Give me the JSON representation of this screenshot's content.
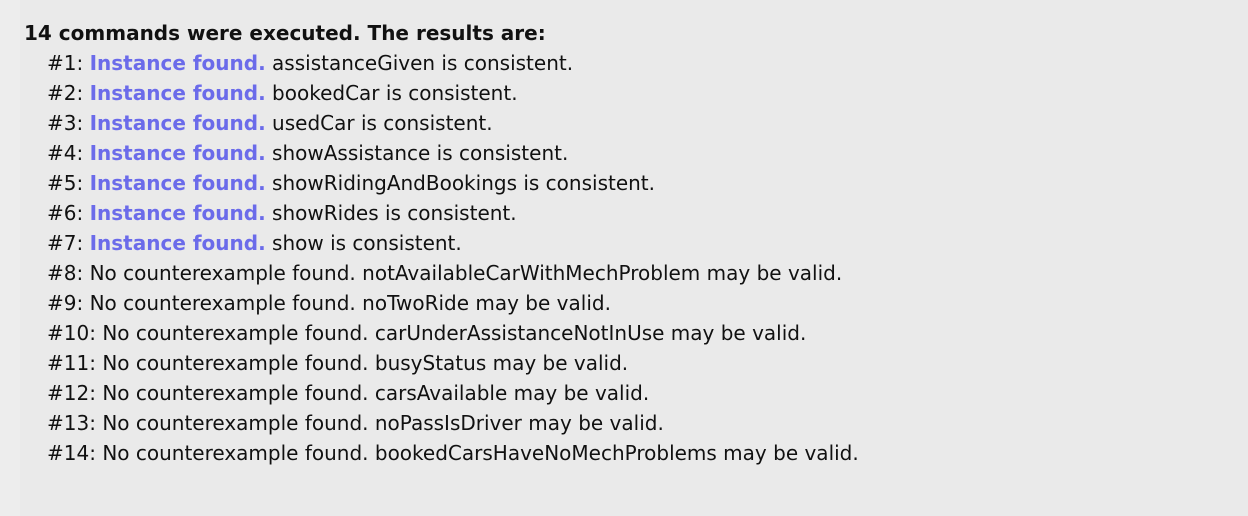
{
  "heading": "14 commands were executed. The results are:",
  "accent_color": "#6b6bea",
  "results": [
    {
      "num": "#1:",
      "status": "Instance found.",
      "text": "assistanceGiven is consistent.",
      "highlight": true
    },
    {
      "num": "#2:",
      "status": "Instance found.",
      "text": "bookedCar is consistent.",
      "highlight": true
    },
    {
      "num": "#3:",
      "status": "Instance found.",
      "text": "usedCar is consistent.",
      "highlight": true
    },
    {
      "num": "#4:",
      "status": "Instance found.",
      "text": "showAssistance is consistent.",
      "highlight": true
    },
    {
      "num": "#5:",
      "status": "Instance found.",
      "text": "showRidingAndBookings is consistent.",
      "highlight": true
    },
    {
      "num": "#6:",
      "status": "Instance found.",
      "text": "showRides is consistent.",
      "highlight": true
    },
    {
      "num": "#7:",
      "status": "Instance found.",
      "text": "show is consistent.",
      "highlight": true
    },
    {
      "num": "#8:",
      "status": "No counterexample found.",
      "text": "notAvailableCarWithMechProblem may be valid.",
      "highlight": false
    },
    {
      "num": "#9:",
      "status": "No counterexample found.",
      "text": "noTwoRide may be valid.",
      "highlight": false
    },
    {
      "num": "#10:",
      "status": "No counterexample found.",
      "text": "carUnderAssistanceNotInUse may be valid.",
      "highlight": false
    },
    {
      "num": "#11:",
      "status": "No counterexample found.",
      "text": "busyStatus may be valid.",
      "highlight": false
    },
    {
      "num": "#12:",
      "status": "No counterexample found.",
      "text": "carsAvailable may be valid.",
      "highlight": false
    },
    {
      "num": "#13:",
      "status": "No counterexample found.",
      "text": "noPassIsDriver may be valid.",
      "highlight": false
    },
    {
      "num": "#14:",
      "status": "No counterexample found.",
      "text": "bookedCarsHaveNoMechProblems may be valid.",
      "highlight": false
    }
  ]
}
